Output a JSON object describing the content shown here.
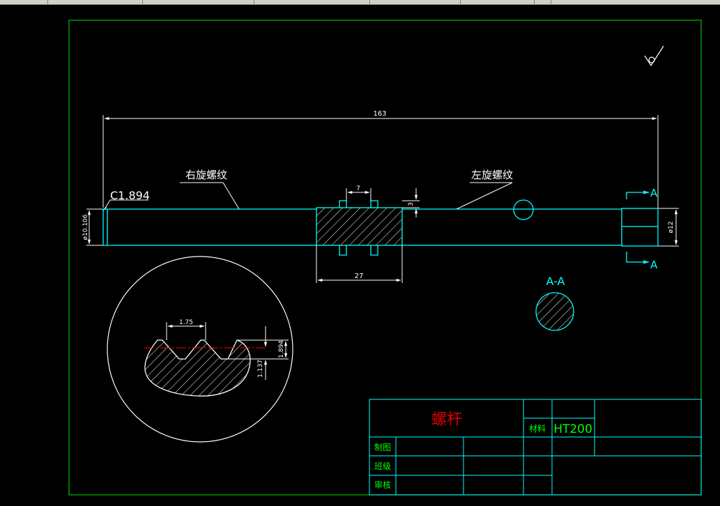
{
  "drawing": {
    "part_name": "螺杆",
    "material_label": "材料",
    "material_value": "HT200",
    "title_rows": [
      "制图",
      "班级",
      "审核"
    ],
    "labels": {
      "right_thread": "右旋螺纹",
      "left_thread": "左旋螺纹",
      "chamfer": "C1.894",
      "section_title": "A-A",
      "section_mark_top": "A",
      "section_mark_bottom": "A"
    },
    "dimensions": {
      "overall_length": "163",
      "left_diameter": "ø10.106",
      "right_diameter": "ø12",
      "groove_width": "7",
      "groove_depth": "3",
      "hatched_length": "27",
      "thread_pitch": "1.75",
      "thread_depth": "1.894",
      "thread_root": "1.137"
    },
    "colors": {
      "background": "#000000",
      "border": "#00c000",
      "outline": "#00ffff",
      "dimension": "#ffffff",
      "part_name": "#e00000",
      "material": "#00ff00",
      "centerline": "#ff0000"
    },
    "symbols": [
      "surface-finish-icon"
    ]
  }
}
